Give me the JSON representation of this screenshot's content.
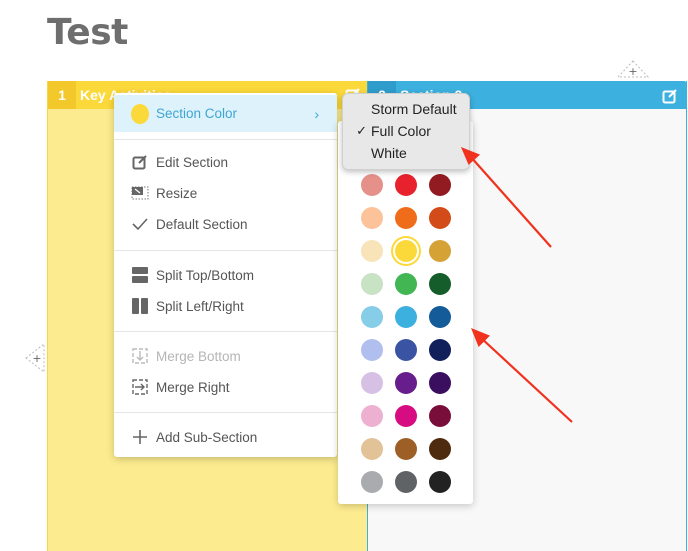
{
  "page": {
    "title": "Test"
  },
  "sections": [
    {
      "number": "1",
      "title": "Key Activities",
      "color": "#fcd93a"
    },
    {
      "number": "2",
      "title": "Section 2",
      "color": "#3cb0de"
    }
  ],
  "context_menu": {
    "section_color_label": "Section Color",
    "items": [
      {
        "label": "Edit Section",
        "icon": "edit-icon"
      },
      {
        "label": "Resize",
        "icon": "resize-icon"
      },
      {
        "label": "Default Section",
        "icon": "check-icon"
      },
      {
        "label": "Split Top/Bottom",
        "icon": "split-top-bottom-icon"
      },
      {
        "label": "Split Left/Right",
        "icon": "split-left-right-icon"
      },
      {
        "label": "Merge Bottom",
        "icon": "merge-bottom-icon",
        "disabled": true
      },
      {
        "label": "Merge Right",
        "icon": "merge-right-icon"
      },
      {
        "label": "Add Sub-Section",
        "icon": "plus-icon"
      }
    ]
  },
  "style_menu": {
    "options": [
      "Storm Default",
      "Full Color",
      "White"
    ],
    "selected": "Full Color",
    "check_mark": "✓"
  },
  "color_palette": {
    "selected": "#fcd93a",
    "rows": [
      [
        "#e5918a",
        "#e8212e",
        "#921b22"
      ],
      [
        "#fcc39b",
        "#ef6d1a",
        "#d24b18"
      ],
      [
        "#f8e4b8",
        "#fcd93a",
        "#d5a235"
      ],
      [
        "#c8e3c3",
        "#41b652",
        "#155d2a"
      ],
      [
        "#86cde8",
        "#3cb0de",
        "#135b99"
      ],
      [
        "#b0bfee",
        "#3a54a3",
        "#111f5b"
      ],
      [
        "#d6c1e5",
        "#681d8c",
        "#3a0f5f"
      ],
      [
        "#eeb0d1",
        "#d80c82",
        "#7a0e3b"
      ],
      [
        "#e2c297",
        "#9e5f27",
        "#4e2b0e"
      ],
      [
        "#a9abae",
        "#5f6366",
        "#222222"
      ]
    ]
  },
  "add_buttons": {
    "symbol": "+"
  }
}
